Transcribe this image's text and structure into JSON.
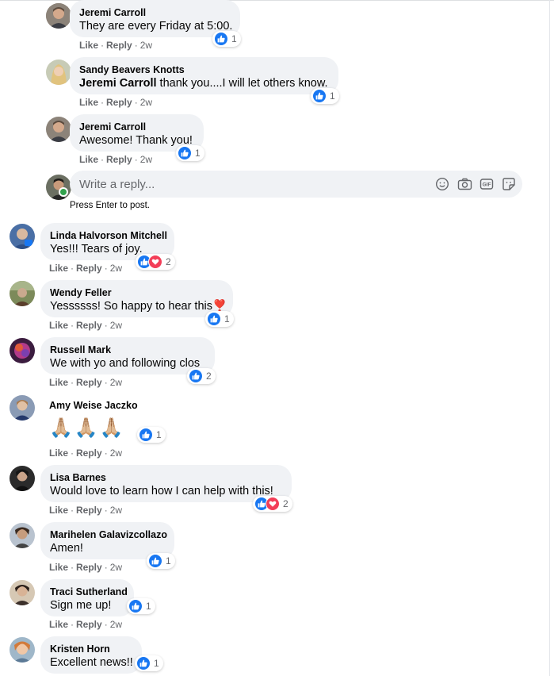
{
  "meta": {
    "like": "Like",
    "reply": "Reply"
  },
  "replies": [
    {
      "author": "Jeremi Carroll",
      "text": "They are every Friday at 5:00.",
      "reaction_count": "1",
      "age": "2w"
    },
    {
      "author": "Sandy Beavers Knotts",
      "mention": "Jeremi Carroll",
      "text": " thank you....I will let others know.",
      "reaction_count": "1",
      "age": "2w"
    },
    {
      "author": "Jeremi Carroll",
      "text": "Awesome! Thank you!",
      "reaction_count": "1",
      "age": "2w"
    }
  ],
  "reply_composer": {
    "placeholder": "Write a reply...",
    "hint": "Press Enter to post.",
    "icons": [
      "emoji-icon",
      "camera-icon",
      "gif-icon",
      "sticker-icon"
    ]
  },
  "comments": [
    {
      "author": "Linda Halvorson Mitchell",
      "text": "Yes!!! Tears of joy.",
      "reactions": [
        "like",
        "love"
      ],
      "reaction_count": "2",
      "age": "2w"
    },
    {
      "author": "Wendy Feller",
      "text": "Yessssss! So happy to hear this❣️",
      "reactions": [
        "like"
      ],
      "reaction_count": "1",
      "age": "2w"
    },
    {
      "author": "Russell Mark",
      "text": "We with yo and following clos",
      "reactions": [
        "like"
      ],
      "reaction_count": "2",
      "age": "2w"
    },
    {
      "author": "Amy Weise Jaczko",
      "text": "🙏🏼🙏🏼🙏🏼",
      "reactions": [
        "like"
      ],
      "reaction_count": "1",
      "age": "2w"
    },
    {
      "author": "Lisa Barnes",
      "text": "Would love to learn how I can help with this!",
      "reactions": [
        "like",
        "love"
      ],
      "reaction_count": "2",
      "age": "2w"
    },
    {
      "author": "Marihelen Galavizcollazo",
      "text": "Amen!",
      "reactions": [
        "like"
      ],
      "reaction_count": "1",
      "age": "2w"
    },
    {
      "author": "Traci Sutherland",
      "text": "Sign me up!",
      "reactions": [
        "like"
      ],
      "reaction_count": "1",
      "age": "2w"
    },
    {
      "author": "Kristen Horn",
      "text": "Excellent news!!",
      "reactions": [
        "like"
      ],
      "reaction_count": "1",
      "age": "2w"
    }
  ],
  "colors": {
    "bubble": "#f0f2f5",
    "like": "#1877f2",
    "love": "#f33e58",
    "meta": "#65676b"
  }
}
